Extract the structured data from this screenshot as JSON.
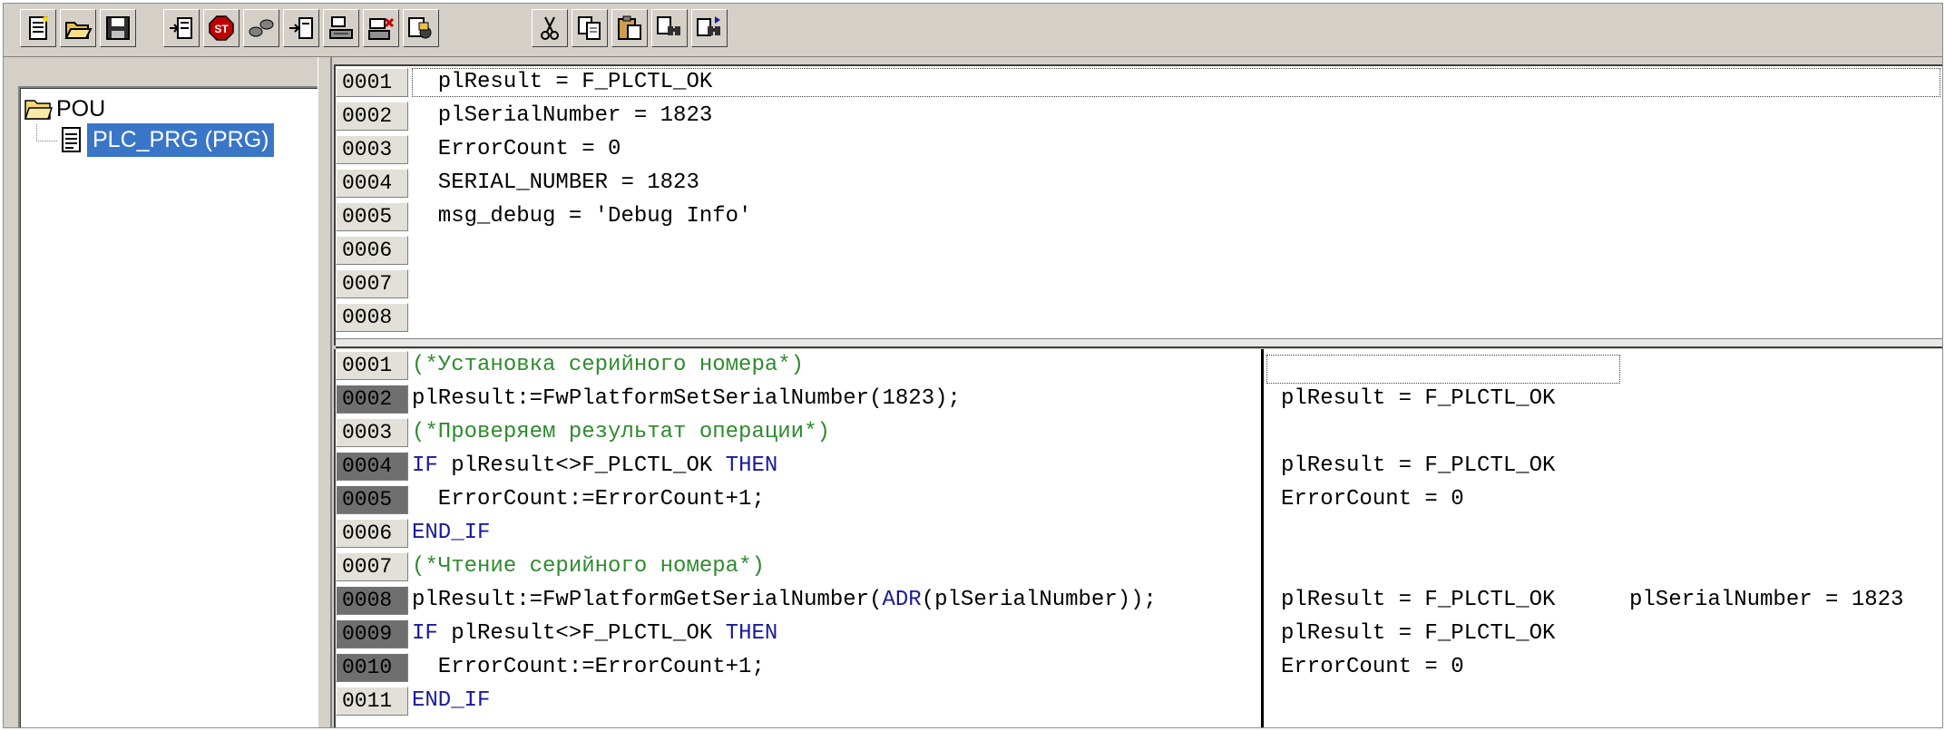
{
  "toolbar": {
    "buttons": [
      {
        "name": "new-file",
        "icon": "new-document-icon"
      },
      {
        "name": "open-file",
        "icon": "open-folder-icon"
      },
      {
        "name": "save-file",
        "icon": "save-disk-icon"
      },
      {
        "name": "login",
        "icon": "login-icon"
      },
      {
        "name": "stop",
        "icon": "stop-icon",
        "label": "ST"
      },
      {
        "name": "run",
        "icon": "run-icon"
      },
      {
        "name": "step-in",
        "icon": "step-in-icon"
      },
      {
        "name": "step-over",
        "icon": "step-over-icon"
      },
      {
        "name": "toggle-breakpoint",
        "icon": "breakpoint-icon"
      },
      {
        "name": "monitor",
        "icon": "monitor-icon"
      },
      {
        "name": "cut",
        "icon": "scissors-icon"
      },
      {
        "name": "copy",
        "icon": "copy-icon"
      },
      {
        "name": "paste",
        "icon": "paste-icon"
      },
      {
        "name": "find",
        "icon": "find-icon"
      },
      {
        "name": "find-next",
        "icon": "find-next-icon"
      }
    ]
  },
  "tree": {
    "root": "POU",
    "child": "PLC_PRG (PRG)"
  },
  "declaration": {
    "lines": [
      {
        "num": "0001",
        "text": "  plResult = F_PLCTL_OK"
      },
      {
        "num": "0002",
        "text": "  plSerialNumber = 1823"
      },
      {
        "num": "0003",
        "text": "  ErrorCount = 0"
      },
      {
        "num": "0004",
        "text": "  SERIAL_NUMBER = 1823"
      },
      {
        "num": "0005",
        "text": "  msg_debug = 'Debug Info'"
      },
      {
        "num": "0006",
        "text": ""
      },
      {
        "num": "0007",
        "text": ""
      },
      {
        "num": "0008",
        "text": ""
      }
    ]
  },
  "body": {
    "lines": [
      {
        "num": "0001",
        "bp": false
      },
      {
        "num": "0002",
        "bp": true
      },
      {
        "num": "0003",
        "bp": false
      },
      {
        "num": "0004",
        "bp": true
      },
      {
        "num": "0005",
        "bp": true
      },
      {
        "num": "0006",
        "bp": false
      },
      {
        "num": "0007",
        "bp": false
      },
      {
        "num": "0008",
        "bp": true
      },
      {
        "num": "0009",
        "bp": true
      },
      {
        "num": "0010",
        "bp": true
      },
      {
        "num": "0011",
        "bp": false
      }
    ],
    "code": {
      "l1": "(*Установка серийного номера*)",
      "l2": "plResult:=FwPlatformSetSerialNumber(1823);",
      "l3": "(*Проверяем результат операции*)",
      "l4_kw1": "IF",
      "l4_mid": " plResult<>F_PLCTL_OK ",
      "l4_kw2": "THEN",
      "l5": "  ErrorCount:=ErrorCount+1;",
      "l6": "END_IF",
      "l7": "(*Чтение серийного номера*)",
      "l8_a": "plResult:=FwPlatformGetSerialNumber(",
      "l8_kw": "ADR",
      "l8_b": "(plSerialNumber));",
      "l9_kw1": "IF",
      "l9_mid": " plResult<>F_PLCTL_OK ",
      "l9_kw2": "THEN",
      "l10": "  ErrorCount:=ErrorCount+1;",
      "l11": "END_IF"
    },
    "monitor": {
      "m2": "plResult = F_PLCTL_OK",
      "m4": "plResult = F_PLCTL_OK",
      "m5": "ErrorCount = 0",
      "m8a": "plResult = F_PLCTL_OK",
      "m8b": "plSerialNumber = 1823",
      "m9": "plResult = F_PLCTL_OK",
      "m10": "ErrorCount = 0"
    }
  }
}
